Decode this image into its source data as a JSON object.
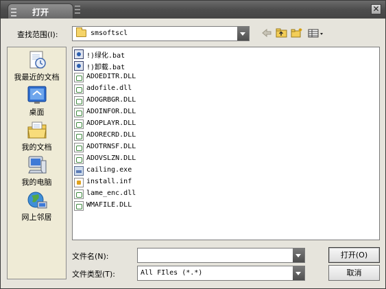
{
  "window": {
    "title": "打开",
    "close_glyph": "✕"
  },
  "lookin": {
    "label": "查找范围(I):",
    "value": "smsoftscl"
  },
  "toolbar": {
    "back_icon": "back-arrow-icon",
    "up_icon": "up-folder-icon",
    "newfolder_icon": "new-folder-icon",
    "views_icon": "views-menu-icon"
  },
  "places": [
    {
      "label": "我最近的文档",
      "icon": "recent-documents-icon"
    },
    {
      "label": "桌面",
      "icon": "desktop-icon"
    },
    {
      "label": "我的文档",
      "icon": "my-documents-icon"
    },
    {
      "label": "我的电脑",
      "icon": "my-computer-icon"
    },
    {
      "label": "网上邻居",
      "icon": "network-places-icon"
    }
  ],
  "files": [
    {
      "name": "!)绿化.bat",
      "type": "bat"
    },
    {
      "name": "!)卸载.bat",
      "type": "bat"
    },
    {
      "name": "ADOEDITR.DLL",
      "type": "dll"
    },
    {
      "name": "adofile.dll",
      "type": "dll"
    },
    {
      "name": "ADOGRBGR.DLL",
      "type": "dll"
    },
    {
      "name": "ADOINFOR.DLL",
      "type": "dll"
    },
    {
      "name": "ADOPLAYR.DLL",
      "type": "dll"
    },
    {
      "name": "ADORECRD.DLL",
      "type": "dll"
    },
    {
      "name": "ADOTRNSF.DLL",
      "type": "dll"
    },
    {
      "name": "ADOVSLZN.DLL",
      "type": "dll"
    },
    {
      "name": "cailing.exe",
      "type": "exe"
    },
    {
      "name": "install.inf",
      "type": "inf"
    },
    {
      "name": "lame_enc.dll",
      "type": "dll"
    },
    {
      "name": "WMAFILE.DLL",
      "type": "dll"
    }
  ],
  "filename": {
    "label": "文件名(N):",
    "value": ""
  },
  "filetype": {
    "label": "文件类型(T):",
    "value": "All FIles (*.*)"
  },
  "buttons": {
    "open": "打开(O)",
    "cancel": "取消"
  }
}
